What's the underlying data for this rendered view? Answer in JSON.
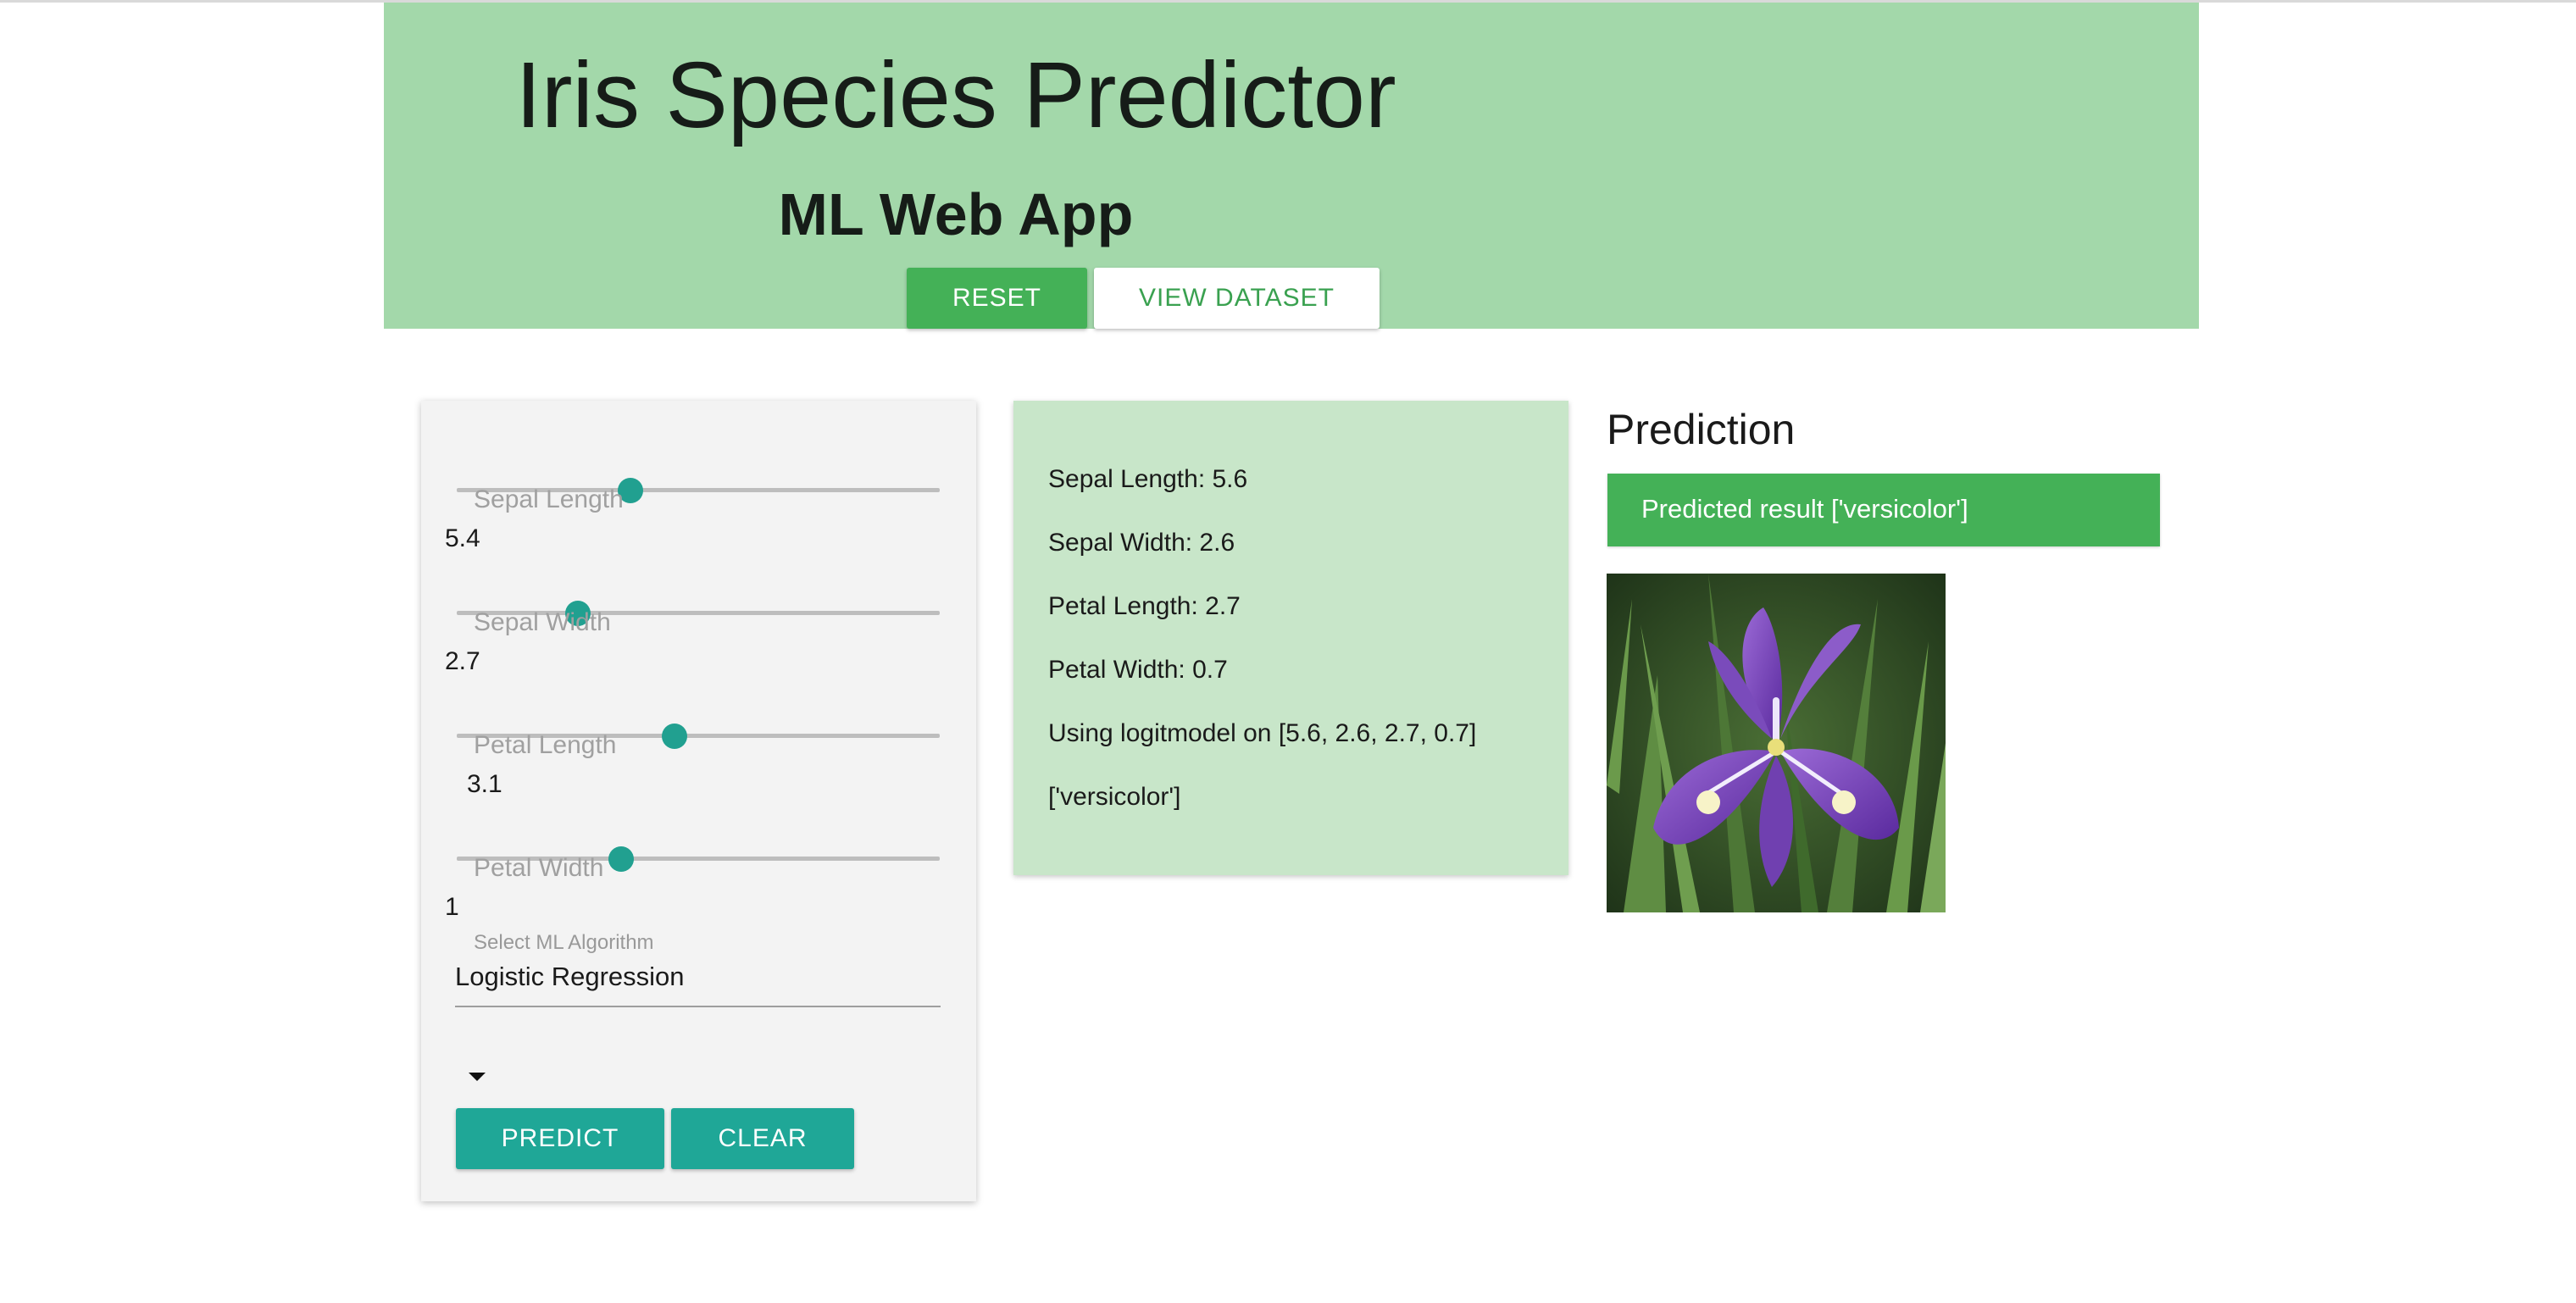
{
  "header": {
    "title": "Iris Species Predictor",
    "subtitle": "ML Web App",
    "reset_label": "RESET",
    "dataset_label": "VIEW DATASET"
  },
  "inputs": {
    "sliders": [
      {
        "label": "Sepal Length",
        "value": "5.4",
        "level": 0.36
      },
      {
        "label": "Sepal Width",
        "value": "2.7",
        "level": 0.25
      },
      {
        "label": "Petal Length",
        "value": "3.1",
        "level": 0.45
      },
      {
        "label": "Petal Width",
        "value": "1",
        "level": 0.34
      }
    ],
    "algorithm_label": "Select ML Algorithm",
    "algorithm_value": "Logistic Regression",
    "predict_label": "PREDICT",
    "clear_label": "CLEAR"
  },
  "summary": {
    "lines": [
      "Sepal Length: 5.6",
      "Sepal Width: 2.6",
      "Petal Length: 2.7",
      "Petal Width: 0.7",
      "Using logitmodel on [5.6, 2.6, 2.7, 0.7]",
      "['versicolor']"
    ]
  },
  "prediction": {
    "title": "Prediction",
    "result": "Predicted result ['versicolor']",
    "image_subject": "iris-versicolor-flower"
  },
  "colors": {
    "header_bg": "#a3d8aa",
    "accent_green": "#44b157",
    "teal": "#1fa797",
    "summary_bg": "#c8e6c9"
  }
}
